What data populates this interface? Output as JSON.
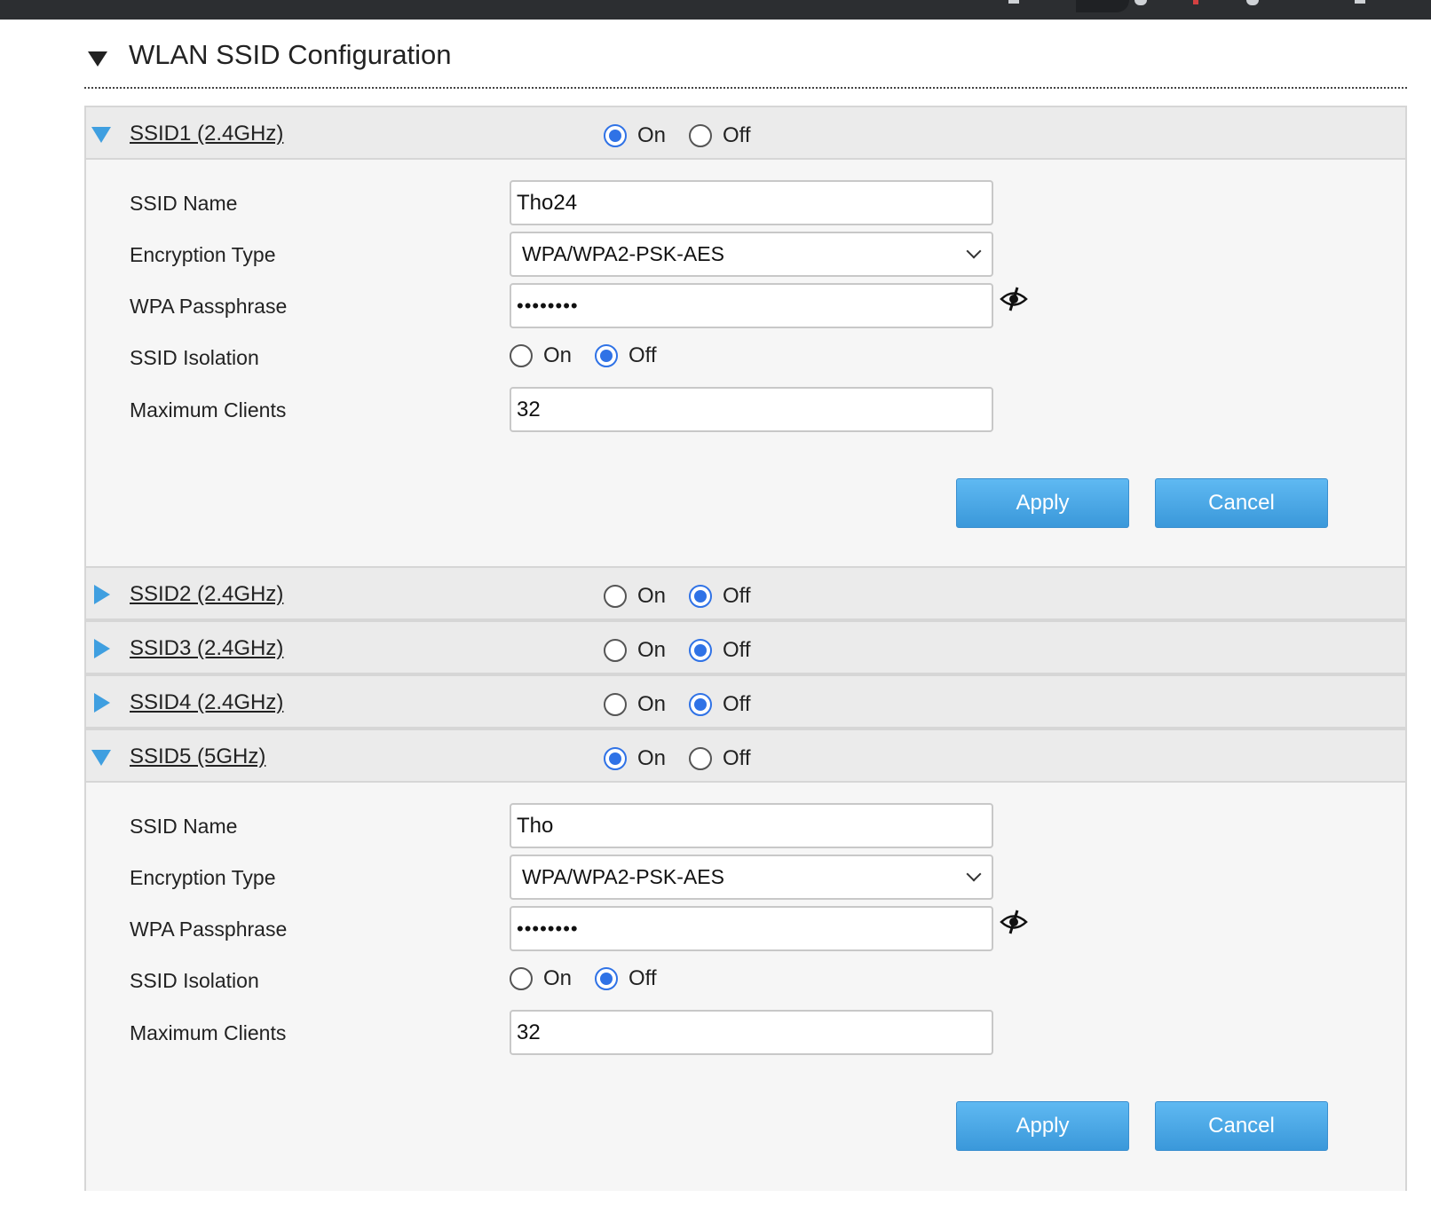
{
  "section": {
    "title": "WLAN SSID Configuration"
  },
  "labels": {
    "on": "On",
    "off": "Off",
    "ssid_name": "SSID Name",
    "encryption_type": "Encryption Type",
    "wpa_passphrase": "WPA Passphrase",
    "ssid_isolation": "SSID Isolation",
    "maximum_clients": "Maximum Clients",
    "apply": "Apply",
    "cancel": "Cancel"
  },
  "ssids": [
    {
      "name": "SSID1 (2.4GHz)",
      "enabled": "On",
      "expanded": true,
      "ssid_name": "Tho24",
      "encryption": "WPA/WPA2-PSK-AES",
      "passphrase": "••••••••",
      "isolation": "Off",
      "max_clients": "32"
    },
    {
      "name": "SSID2 (2.4GHz)",
      "enabled": "Off",
      "expanded": false
    },
    {
      "name": "SSID3 (2.4GHz)",
      "enabled": "Off",
      "expanded": false
    },
    {
      "name": "SSID4 (2.4GHz)",
      "enabled": "Off",
      "expanded": false
    },
    {
      "name": "SSID5 (5GHz)",
      "enabled": "On",
      "expanded": true,
      "ssid_name": "Tho",
      "encryption": "WPA/WPA2-PSK-AES",
      "passphrase": "••••••••",
      "isolation": "Off",
      "max_clients": "32"
    }
  ],
  "colors": {
    "accent": "#3f9fe0",
    "radio_checked": "#2f72e6",
    "button": "#4aa8e6"
  }
}
